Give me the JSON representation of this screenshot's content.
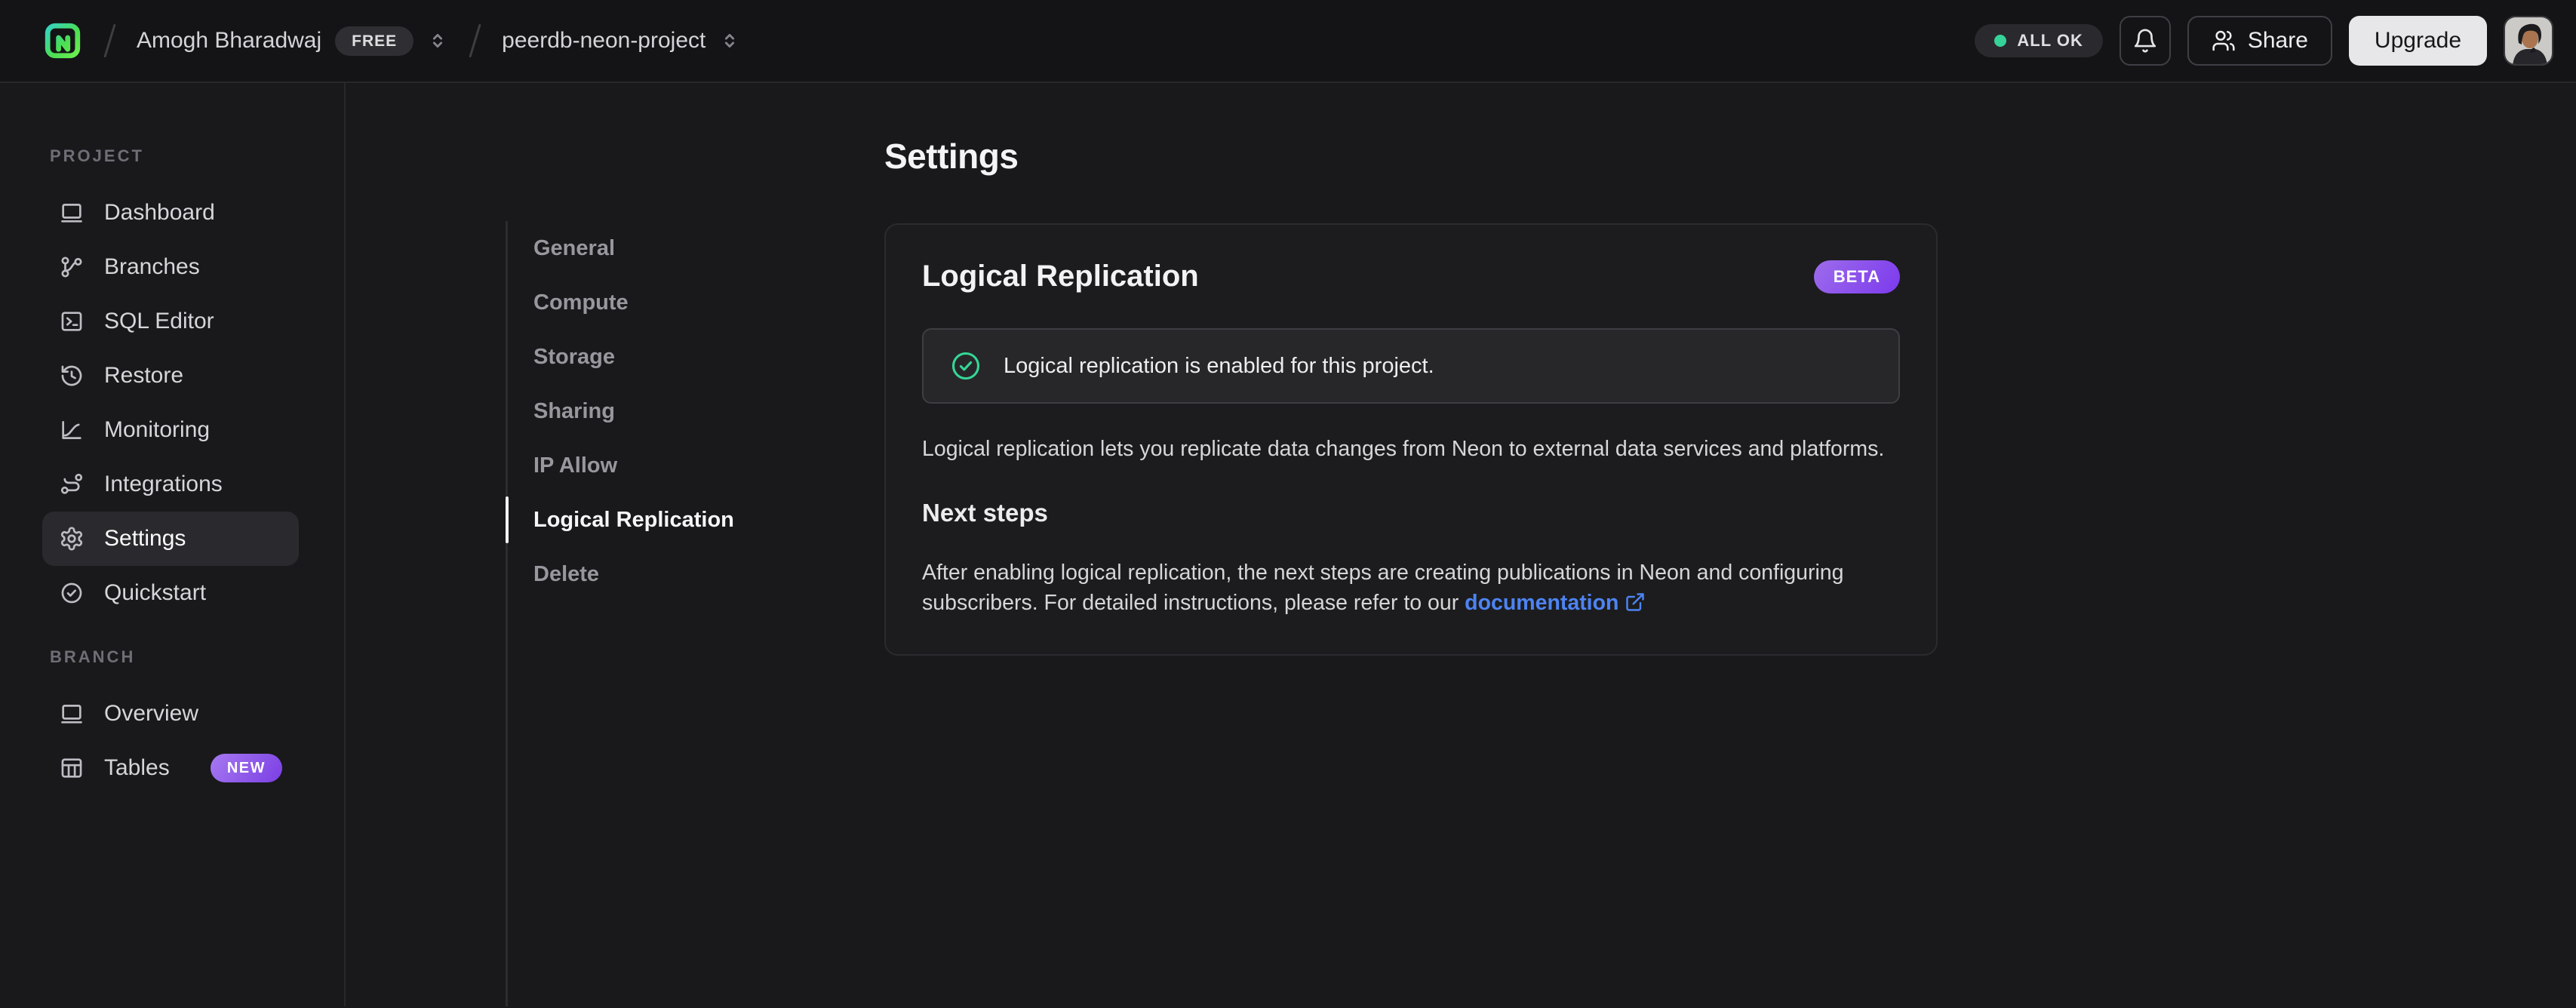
{
  "topbar": {
    "breadcrumb": {
      "org_name": "Amogh Bharadwaj",
      "org_badge": "FREE",
      "project_name": "peerdb-neon-project"
    },
    "status_label": "ALL OK",
    "share_label": "Share",
    "upgrade_label": "Upgrade"
  },
  "sidebar": {
    "sections": [
      {
        "label": "PROJECT",
        "items": [
          {
            "label": "Dashboard",
            "icon": "dashboard-icon"
          },
          {
            "label": "Branches",
            "icon": "git-branch-icon"
          },
          {
            "label": "SQL Editor",
            "icon": "terminal-icon"
          },
          {
            "label": "Restore",
            "icon": "history-icon"
          },
          {
            "label": "Monitoring",
            "icon": "chart-icon"
          },
          {
            "label": "Integrations",
            "icon": "route-icon"
          },
          {
            "label": "Settings",
            "icon": "gear-icon",
            "active": true
          },
          {
            "label": "Quickstart",
            "icon": "check-circle-icon"
          }
        ]
      },
      {
        "label": "BRANCH",
        "items": [
          {
            "label": "Overview",
            "icon": "window-icon"
          },
          {
            "label": "Tables",
            "icon": "table-icon",
            "badge": "NEW"
          }
        ]
      }
    ]
  },
  "settings_nav": {
    "items": [
      {
        "label": "General"
      },
      {
        "label": "Compute"
      },
      {
        "label": "Storage"
      },
      {
        "label": "Sharing"
      },
      {
        "label": "IP Allow"
      },
      {
        "label": "Logical Replication",
        "active": true
      },
      {
        "label": "Delete"
      }
    ]
  },
  "main": {
    "page_title": "Settings",
    "card": {
      "title": "Logical Replication",
      "badge": "BETA",
      "alert_text": "Logical replication is enabled for this project.",
      "description": "Logical replication lets you replicate data changes from Neon to external data services and platforms.",
      "next_steps_title": "Next steps",
      "next_steps_text": "After enabling logical replication, the next steps are creating publications in Neon and configuring subscribers. For detailed instructions, please refer to our ",
      "link_label": "documentation"
    }
  },
  "colors": {
    "accent_green": "#35d399",
    "badge_purple_start": "#9d6ceb",
    "badge_purple_end": "#7c3aed",
    "link_blue": "#4d84f3",
    "background": "#19191b",
    "topbar_background": "#141416"
  }
}
